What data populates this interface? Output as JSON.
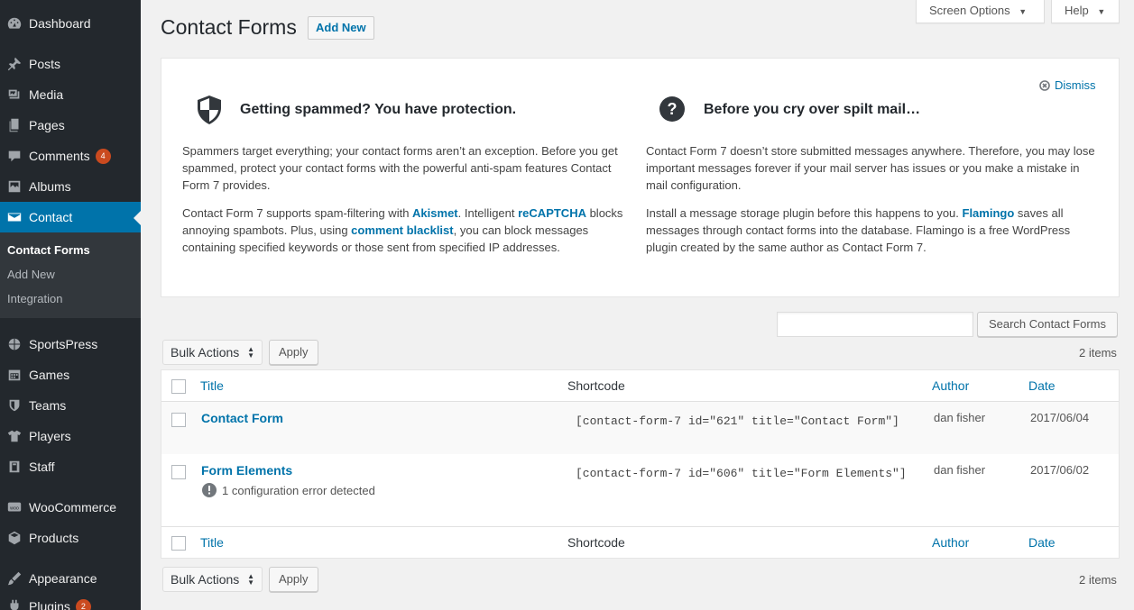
{
  "sidebar": {
    "items": [
      {
        "label": "Dashboard",
        "icon": "dashboard-icon"
      },
      {
        "label": "Posts",
        "icon": "pin-icon"
      },
      {
        "label": "Media",
        "icon": "media-icon"
      },
      {
        "label": "Pages",
        "icon": "pages-icon"
      },
      {
        "label": "Comments",
        "icon": "comment-icon",
        "badge": "4"
      },
      {
        "label": "Albums",
        "icon": "albums-icon"
      },
      {
        "label": "Contact",
        "icon": "mail-icon"
      },
      {
        "label": "SportsPress",
        "icon": "sportspress-icon"
      },
      {
        "label": "Games",
        "icon": "calendar-icon"
      },
      {
        "label": "Teams",
        "icon": "shield-icon"
      },
      {
        "label": "Players",
        "icon": "shirt-icon"
      },
      {
        "label": "Staff",
        "icon": "staff-icon"
      },
      {
        "label": "WooCommerce",
        "icon": "woo-icon"
      },
      {
        "label": "Products",
        "icon": "box-icon"
      },
      {
        "label": "Appearance",
        "icon": "brush-icon"
      },
      {
        "label": "Plugins",
        "icon": "plugin-icon",
        "badge": "2"
      }
    ],
    "submenu": [
      "Contact Forms",
      "Add New",
      "Integration"
    ]
  },
  "header": {
    "title": "Contact Forms",
    "add_new": "Add New",
    "screen_options": "Screen Options",
    "help": "Help"
  },
  "welcome": {
    "dismiss": "Dismiss",
    "left_title": "Getting spammed? You have protection.",
    "left_p1": "Spammers target everything; your contact forms aren’t an exception. Before you get spammed, protect your contact forms with the powerful anti-spam features Contact Form 7 provides.",
    "left_p2_a": "Contact Form 7 supports spam-filtering with ",
    "left_p2_akismet": "Akismet",
    "left_p2_b": ". Intelligent ",
    "left_p2_recaptcha": "reCAPTCHA",
    "left_p2_c": " blocks annoying spambots. Plus, using ",
    "left_p2_blacklist": "comment blacklist",
    "left_p2_d": ", you can block messages containing specified keywords or those sent from specified IP addresses.",
    "right_title": "Before you cry over spilt mail…",
    "right_p1": "Contact Form 7 doesn’t store submitted messages anywhere. Therefore, you may lose important messages forever if your mail server has issues or you make a mistake in mail configuration.",
    "right_p2_a": "Install a message storage plugin before this happens to you. ",
    "right_p2_flamingo": "Flamingo",
    "right_p2_b": " saves all messages through contact forms into the database. Flamingo is a free WordPress plugin created by the same author as Contact Form 7."
  },
  "search": {
    "button": "Search Contact Forms",
    "value": ""
  },
  "bulk": {
    "label": "Bulk Actions",
    "apply": "Apply",
    "count": "2 items"
  },
  "table": {
    "columns": {
      "title": "Title",
      "shortcode": "Shortcode",
      "author": "Author",
      "date": "Date"
    },
    "rows": [
      {
        "title": "Contact Form",
        "shortcode": "[contact-form-7 id=\"621\" title=\"Contact Form\"]",
        "author": "dan fisher",
        "date": "2017/06/04"
      },
      {
        "title": "Form Elements",
        "shortcode": "[contact-form-7 id=\"606\" title=\"Form Elements\"]",
        "author": "dan fisher",
        "date": "2017/06/02",
        "error": "1 configuration error detected"
      }
    ]
  },
  "colors": {
    "sidebar": "#23282d",
    "accent": "#0073aa",
    "badge": "#ca4a1f"
  }
}
